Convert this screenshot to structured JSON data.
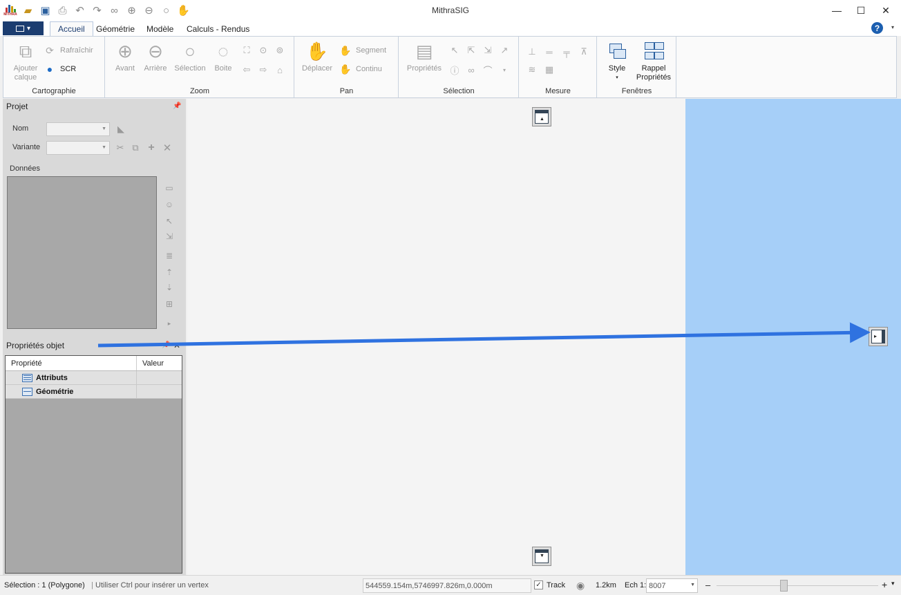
{
  "window": {
    "title": "MithraSIG",
    "logo_text": "MITHRA",
    "minimize": "—",
    "maximize": "☐",
    "close": "✕"
  },
  "qat": {
    "icons": [
      "open-folder-icon",
      "save-icon",
      "print-icon",
      "undo-icon",
      "redo-icon",
      "binoculars-icon",
      "zoom-in-icon",
      "zoom-out-icon",
      "zoom-icon",
      "hand-icon"
    ]
  },
  "tabs": [
    {
      "label": "Accueil",
      "selected": true
    },
    {
      "label": "Géométrie",
      "selected": false
    },
    {
      "label": "Modèle",
      "selected": false
    },
    {
      "label": "Calculs - Rendus",
      "selected": false
    }
  ],
  "help": "?",
  "ribbon": {
    "cartographie": {
      "label": "Cartographie",
      "ajouter_line1": "Ajouter",
      "ajouter_line2": "calque",
      "rafraichir": "Rafraîchir",
      "scr": "SCR"
    },
    "zoom": {
      "label": "Zoom",
      "avant": "Avant",
      "arriere": "Arrière",
      "selection": "Sélection",
      "boite": "Boite"
    },
    "pan": {
      "label": "Pan",
      "deplacer": "Déplacer",
      "segment": "Segment",
      "continu": "Continu"
    },
    "selection": {
      "label": "Sélection",
      "proprietes": "Propriétés"
    },
    "mesure": {
      "label": "Mesure"
    },
    "fenetres": {
      "label": "Fenêtres",
      "style": "Style",
      "rappel_line1": "Rappel",
      "rappel_line2": "Propriétés"
    }
  },
  "projet_panel": {
    "title": "Projet",
    "nom_label": "Nom",
    "variante_label": "Variante",
    "donnees_label": "Données"
  },
  "properties_panel": {
    "title": "Propriétés objet",
    "col_property": "Propriété",
    "col_value": "Valeur",
    "rows": [
      {
        "label": "Attributs",
        "value": ""
      },
      {
        "label": "Géométrie",
        "value": ""
      }
    ]
  },
  "statusbar": {
    "selection": "Sélection : 1 (Polygone)",
    "hint": "Utiliser Ctrl pour insérer un vertex",
    "coords": "544559.154m,5746997.826m,0.000m",
    "track_label": "Track",
    "track_checked": "✓",
    "distance": "1.2km",
    "scale_label": "Ech 1:",
    "scale_value": "8007",
    "zoom_minus": "–",
    "zoom_plus": "+"
  },
  "colors": {
    "accent": "#1c3d70",
    "blue_panel": "#a6cff8",
    "arrow": "#2f72e0"
  }
}
